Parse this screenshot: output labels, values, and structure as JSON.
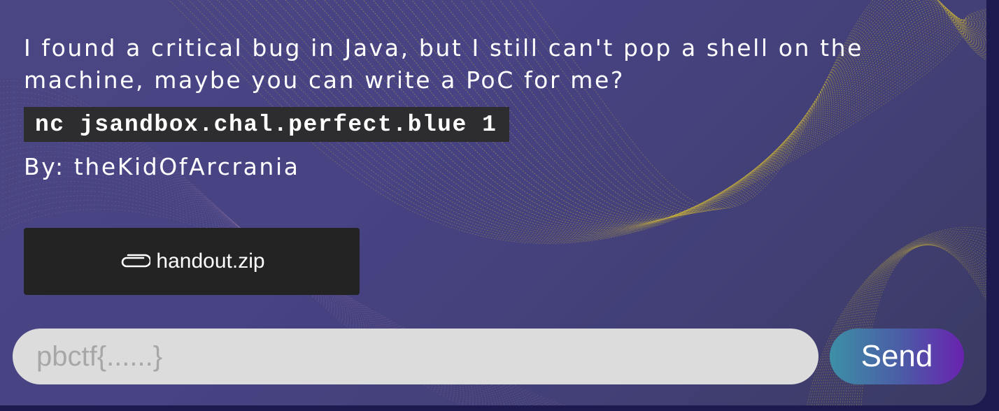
{
  "challenge": {
    "description": "I found a critical bug in Java, but I still can't pop a shell on the machine, maybe you can write a PoC for me?",
    "command": "nc jsandbox.chal.perfect.blue 1",
    "author": "By: theKidOfArcrania"
  },
  "attachment": {
    "icon": "paperclip-icon",
    "filename": "handout.zip"
  },
  "flag_form": {
    "placeholder": "pbctf{......}",
    "value": "",
    "submit_label": "Send"
  },
  "colors": {
    "background_start": "#4b4784",
    "background_end": "#3a3a62",
    "wave_lines": "#c9b23a",
    "code_background": "#2d2d2f",
    "download_button": "#232323",
    "input_background": "#dcdcdc",
    "send_gradient_start": "#3d8fa6",
    "send_gradient_end": "#6a22b0"
  }
}
